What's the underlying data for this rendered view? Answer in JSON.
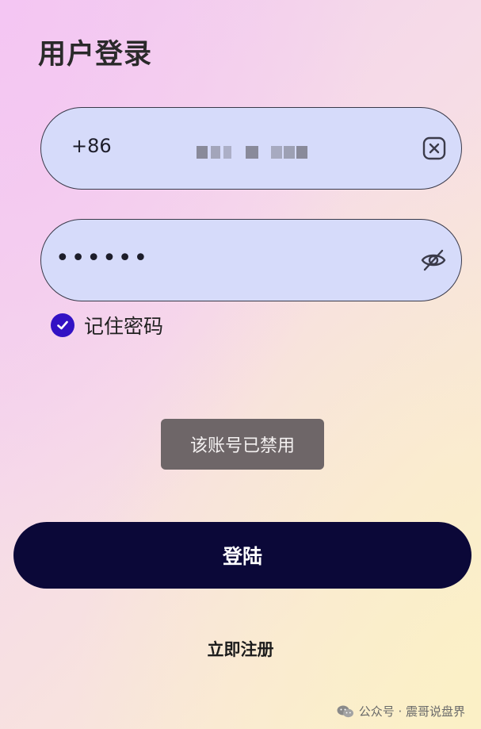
{
  "page": {
    "title": "用户登录"
  },
  "phone": {
    "country_code": "+86"
  },
  "password": {
    "masked_value": "••••••"
  },
  "remember": {
    "label": "记住密码",
    "checked": true
  },
  "toast": {
    "message": "该账号已禁用"
  },
  "actions": {
    "login_label": "登陆",
    "register_label": "立即注册"
  },
  "watermark": {
    "text": "公众号 · 震哥说盘界"
  },
  "colors": {
    "field_bg": "#d6dbfa",
    "button_bg": "#0b0838",
    "checkbox": "#3212c4",
    "toast_bg": "#6e6668"
  },
  "icons": {
    "clear": "close-square-icon",
    "visibility": "eye-off-icon",
    "checkbox": "check-icon",
    "watermark": "wechat-icon"
  }
}
